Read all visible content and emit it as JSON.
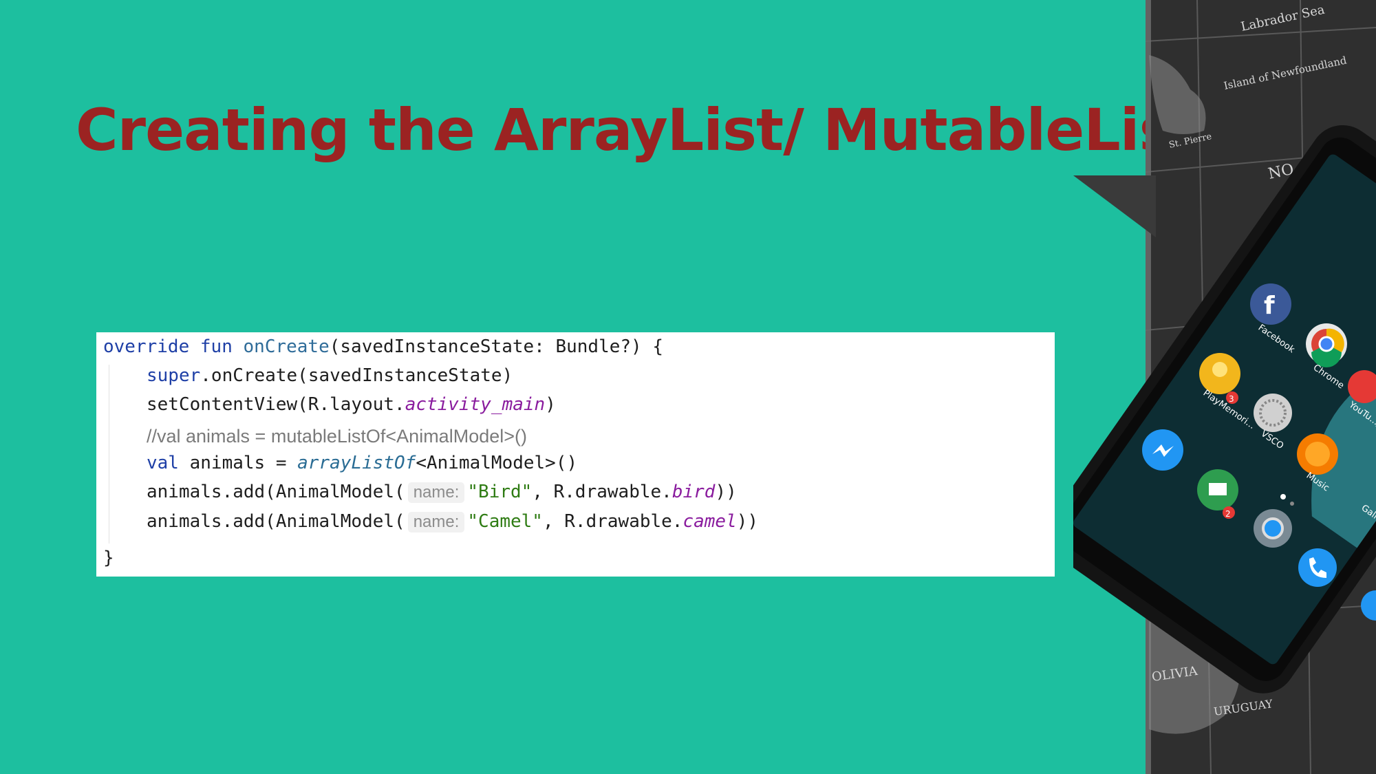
{
  "slide": {
    "title": "Creating the ArrayList/ MutableList"
  },
  "code": {
    "line1": {
      "kw1": "override",
      "kw2": "fun",
      "fname": "onCreate",
      "rest": "(savedInstanceState: Bundle?) {"
    },
    "line2": {
      "kw": "super",
      "rest": ".onCreate(savedInstanceState)"
    },
    "line3": {
      "start": "setContentView(R.layout.",
      "ref": "activity_main",
      "end": ")"
    },
    "line4": {
      "comment": "//val animals = mutableListOf<AnimalModel>()"
    },
    "line5": {
      "kw": "val",
      "mid": " animals = ",
      "fn": "arrayListOf",
      "end": "<AnimalModel>()"
    },
    "line6": {
      "start": "animals.add(AnimalModel(",
      "hint": "name:",
      "str": "\"Bird\"",
      "mid": ", R.drawable.",
      "ref": "bird",
      "end": "))"
    },
    "line7": {
      "start": "animals.add(AnimalModel(",
      "hint": "name:",
      "str": "\"Camel\"",
      "mid": ", R.drawable.",
      "ref": "camel",
      "end": "))"
    },
    "line8": {
      "brace": "}"
    }
  },
  "phone": {
    "map_labels": [
      "Labrador Sea",
      "Island of Newfoundland",
      "St. Pierre",
      "NO",
      "OLIVIA",
      "URUGUAY"
    ],
    "app_labels": [
      "Facebook",
      "Chrome",
      "PlayMemori...",
      "VSCO",
      "YouTu...",
      "Music",
      "Gallery"
    ],
    "badges": [
      "3",
      "2"
    ]
  },
  "colors": {
    "background": "#1dbf9f",
    "title": "#9b2322",
    "code_background": "#ffffff"
  }
}
